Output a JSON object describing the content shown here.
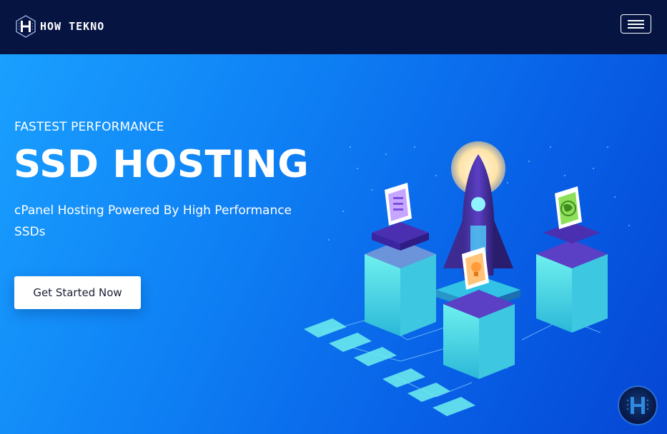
{
  "header": {
    "brand_name": "HOW TEKNO",
    "logo_icon": "hexagon-h-logo-icon",
    "menu_icon": "hamburger-menu-icon"
  },
  "hero": {
    "eyebrow": "FASTEST PERFORMANCE",
    "headline": "SSD HOSTING",
    "subtitle": "cPanel Hosting Powered By High Performance SSDs",
    "cta_label": "Get Started Now",
    "illustration_icons": [
      "server-icon",
      "lightbulb-icon",
      "globe-icon",
      "rocket-icon"
    ]
  },
  "floating_badge": {
    "icon": "hexagon-h-logo-icon"
  },
  "colors": {
    "header_bg": "#061442",
    "hero_gradient_start": "#1aa0ff",
    "hero_gradient_end": "#0546d4",
    "cta_bg": "#ffffff",
    "accent_orange": "#f5a14a",
    "accent_green": "#7bd44a",
    "accent_purple": "#9b7be8"
  }
}
